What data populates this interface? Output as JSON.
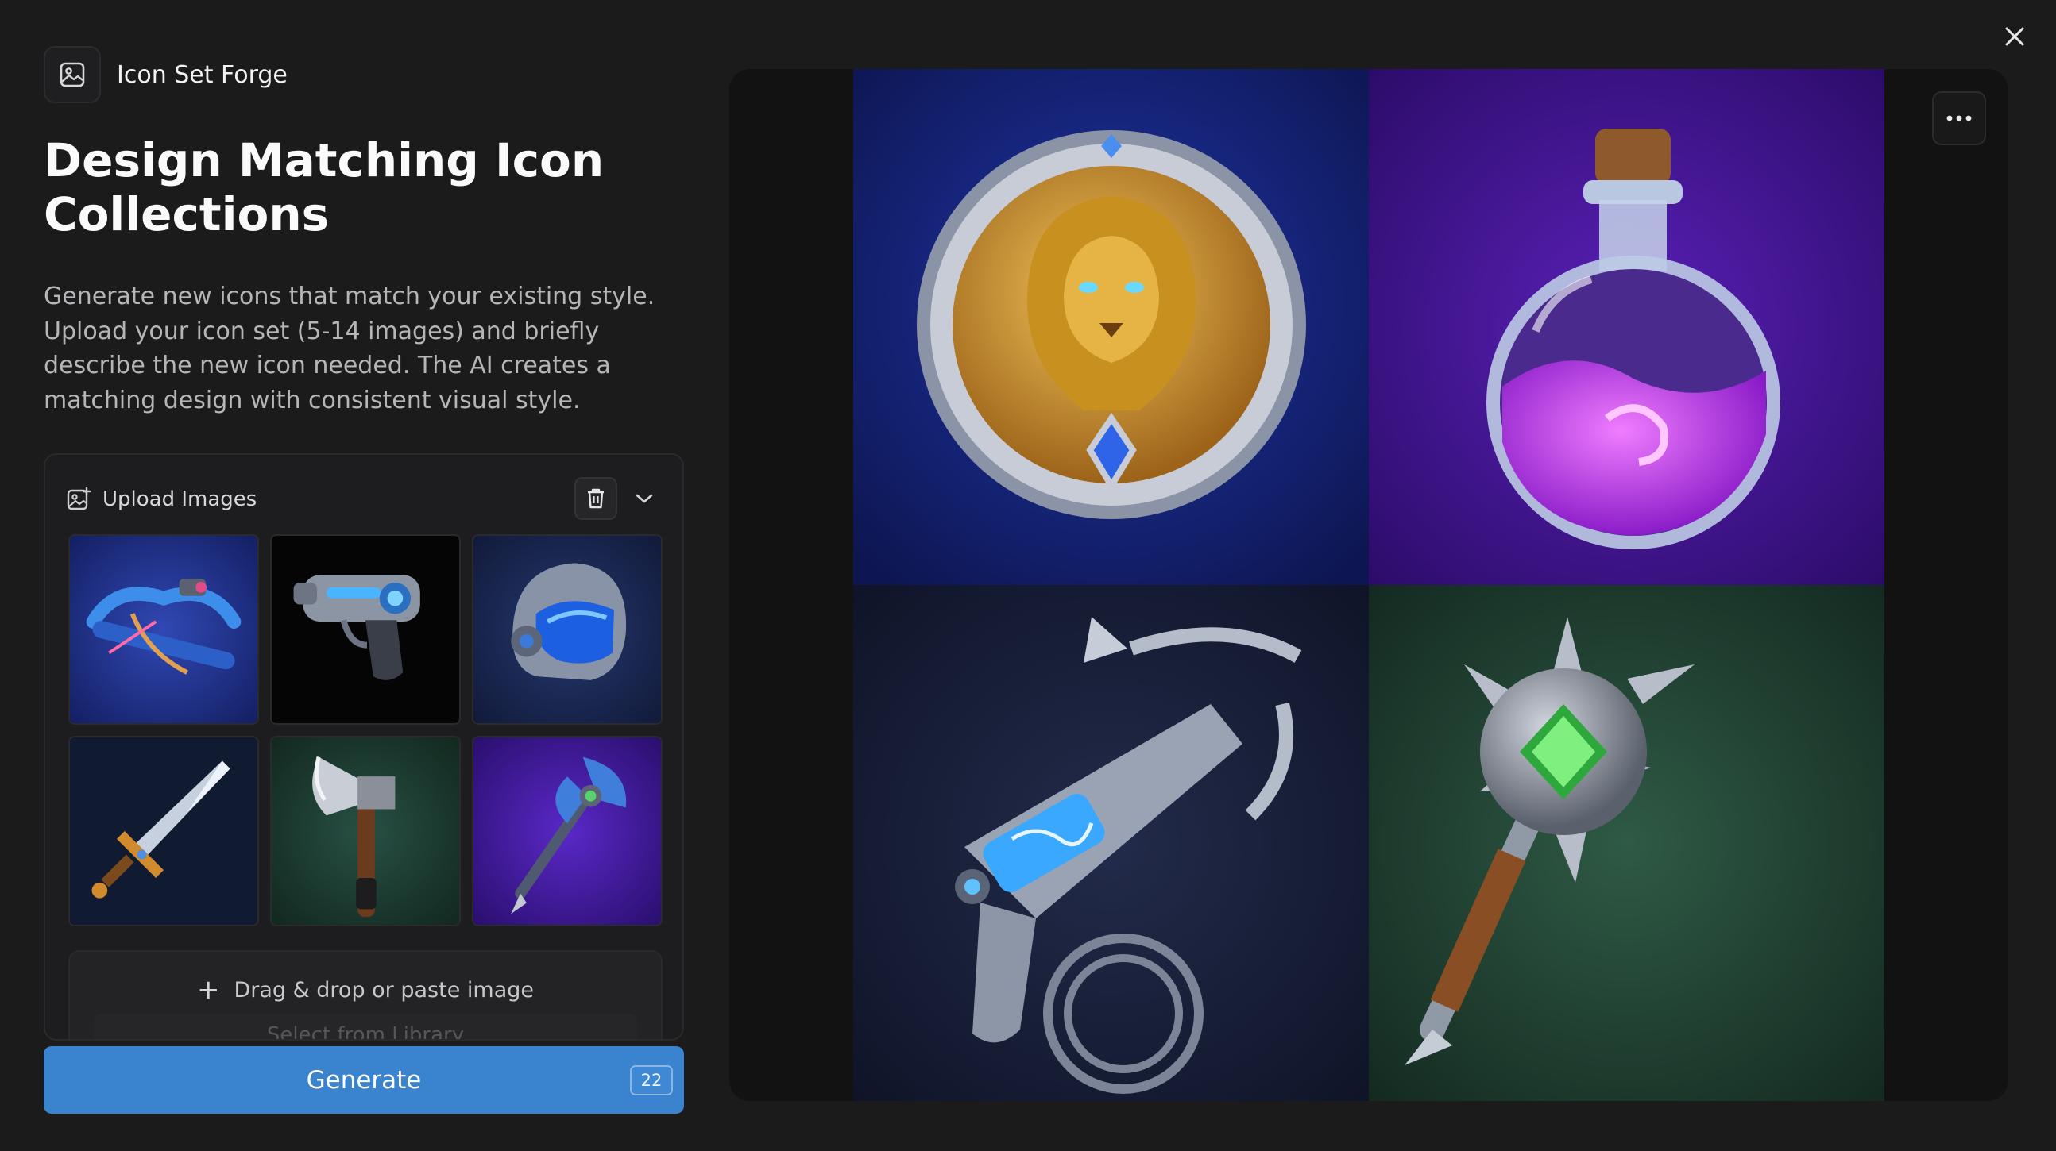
{
  "app": {
    "name": "Icon Set Forge",
    "brand_icon": "image-icon"
  },
  "hero": {
    "title": "Design Matching Icon Collections",
    "description": "Generate new icons that match your existing style. Upload your icon set (5-14 images) and briefly describe the new icon needed. The AI creates a matching design with consistent visual style."
  },
  "upload": {
    "label": "Upload Images",
    "icon": "image-plus-icon",
    "actions": {
      "clear": "trash-icon",
      "collapse": "chevron-down-icon"
    },
    "images": [
      {
        "name": "crossbow",
        "bg": "#1e2f86"
      },
      {
        "name": "laser-pistol",
        "bg": "#050506"
      },
      {
        "name": "space-helmet",
        "bg": "#14204a"
      },
      {
        "name": "sword",
        "bg": "#101a30"
      },
      {
        "name": "axe",
        "bg": "#17342a"
      },
      {
        "name": "battle-axe-staff",
        "bg": "#3d1796"
      }
    ],
    "dropzone_text": "Drag & drop or paste image",
    "library_text": "Select from Library"
  },
  "generate": {
    "label": "Generate",
    "credits": "22",
    "color": "#3a83ce"
  },
  "preview": {
    "more_icon": "more-horizontal-icon",
    "images": [
      {
        "name": "lion-shield-emblem",
        "bg": "#15216e"
      },
      {
        "name": "purple-potion-flask",
        "bg": "#3e1482"
      },
      {
        "name": "grappling-hook-gun",
        "bg": "#161d38"
      },
      {
        "name": "spiked-mace",
        "bg": "#1d3a2c"
      }
    ]
  },
  "close_icon": "close-icon"
}
